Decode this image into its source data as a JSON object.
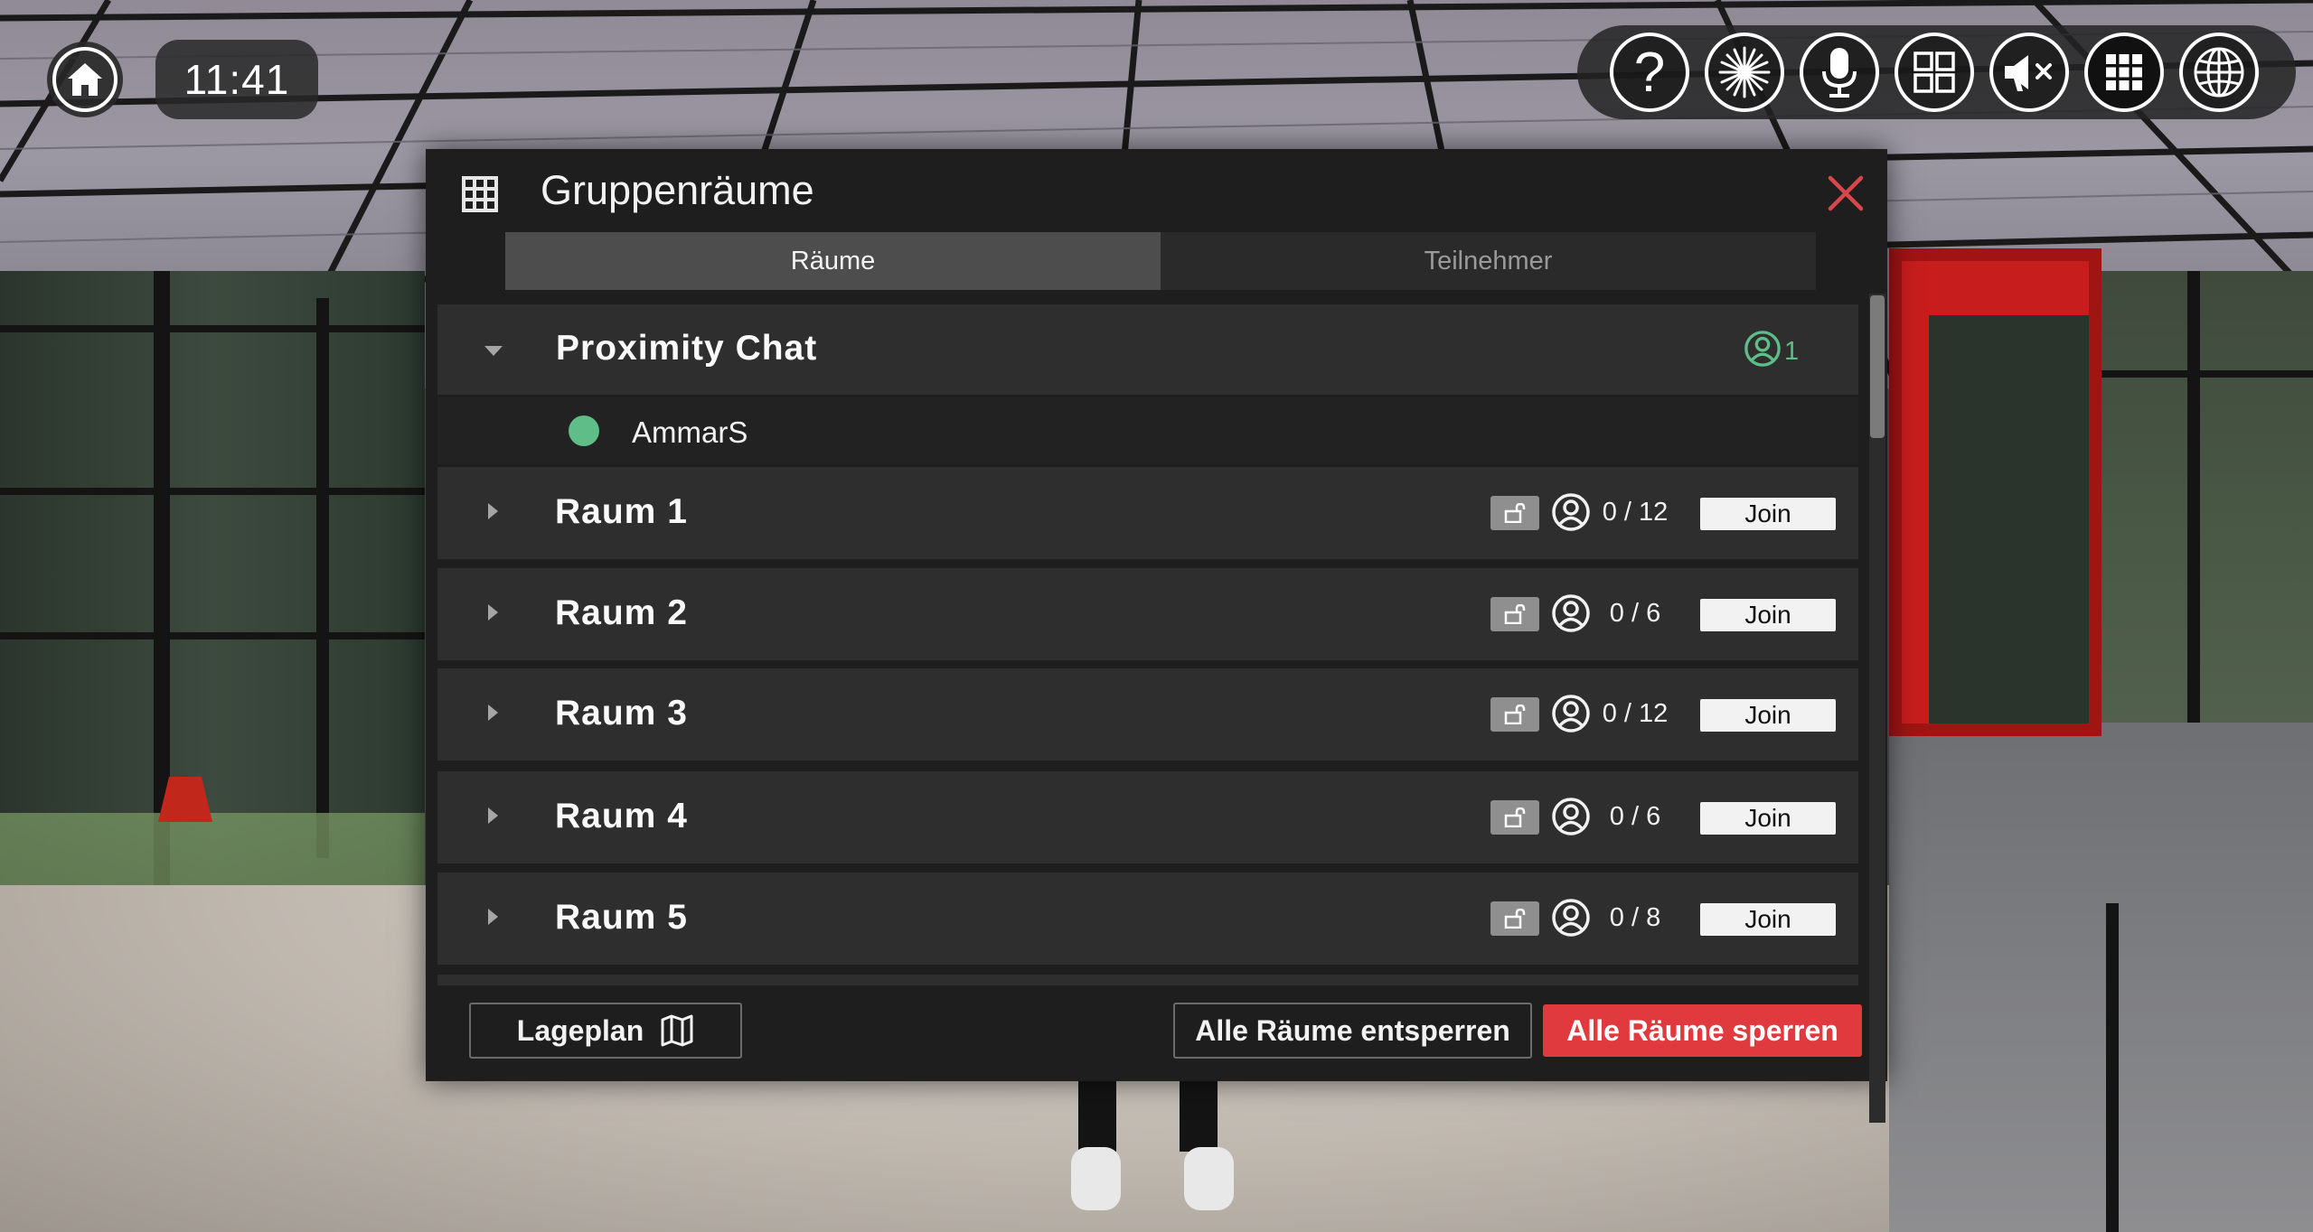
{
  "hud": {
    "time": "11:41",
    "toolbar_icons": [
      "help-icon",
      "laser-pointer-icon",
      "microphone-icon",
      "layout-icon",
      "mute-speaker-icon",
      "group-rooms-icon",
      "globe-icon"
    ]
  },
  "dialog": {
    "title": "Gruppenräume",
    "tabs": [
      {
        "label": "Räume",
        "active": true
      },
      {
        "label": "Teilnehmer",
        "active": false
      }
    ],
    "proximity": {
      "name": "Proximity Chat",
      "count": "1",
      "members": [
        {
          "name": "AmmarS",
          "status_color": "#5fbd87"
        }
      ]
    },
    "rooms": [
      {
        "name": "Raum 1",
        "capacity": "0 / 12",
        "join_label": "Join"
      },
      {
        "name": "Raum 2",
        "capacity": "0 / 6",
        "join_label": "Join"
      },
      {
        "name": "Raum 3",
        "capacity": "0 / 12",
        "join_label": "Join"
      },
      {
        "name": "Raum 4",
        "capacity": "0 / 6",
        "join_label": "Join"
      },
      {
        "name": "Raum 5",
        "capacity": "0 / 8",
        "join_label": "Join"
      }
    ],
    "footer": {
      "map_label": "Lageplan",
      "unlock_all_label": "Alle Räume entsperren",
      "lock_all_label": "Alle Räume sperren"
    }
  },
  "colors": {
    "accent_red": "#e03a3e",
    "online_green": "#5fbd87",
    "close_red": "#d9474b"
  }
}
